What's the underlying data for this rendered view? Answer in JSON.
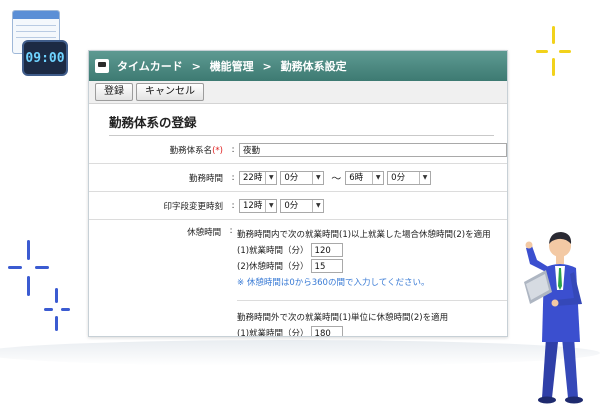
{
  "window": {
    "breadcrumb": [
      "タイムカード",
      "機能管理",
      "勤務体系設定"
    ],
    "separator": ">"
  },
  "toolbar": {
    "register_label": "登録",
    "cancel_label": "キャンセル"
  },
  "section_title": "勤務体系の登録",
  "form": {
    "name": {
      "label": "勤務体系名",
      "required_mark": "(*)",
      "colon": ":",
      "value": "夜勤"
    },
    "work_hours": {
      "label": "勤務時間",
      "colon": ":",
      "start_hour": "22時",
      "start_min": "0分",
      "tilde": "〜",
      "end_hour": "6時",
      "end_min": "0分"
    },
    "stamp_change": {
      "label": "印字段変更時刻",
      "colon": ":",
      "hour": "12時",
      "min": "0分"
    },
    "break": {
      "label": "休憩時間",
      "colon": ":",
      "inside_title": "勤務時間内で次の就業時間(1)以上就業した場合休憩時間(2)を適用",
      "inside_work_label": "(1)就業時間（分）",
      "inside_work_value": "120",
      "inside_break_label": "(2)休憩時間（分）",
      "inside_break_value": "15",
      "note": "※ 休憩時間は0から360の間で入力してください。",
      "outside_title": "勤務時間外で次の就業時間(1)単位に休憩時間(2)を適用",
      "outside_work_label": "(1)就業時間（分）",
      "outside_work_value": "180"
    }
  },
  "app_icon": {
    "clock_text": "09:00"
  },
  "colors": {
    "titlebar": "#4e8a82",
    "sparkle_yellow": "#f2d21b",
    "sparkle_blue": "#3b5bd1",
    "note_blue": "#3a7bd5",
    "required_red": "#e02020"
  }
}
